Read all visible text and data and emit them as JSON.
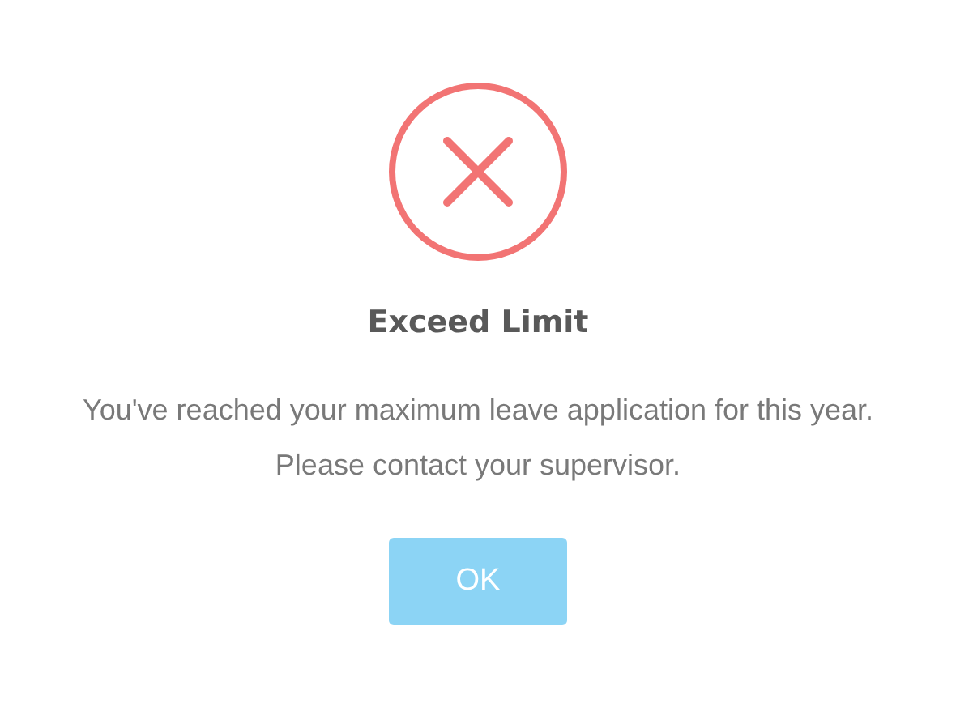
{
  "dialog": {
    "kind": "error",
    "title": "Exceed Limit",
    "message": "You've reached your maximum leave application for this year. Please contact your supervisor.",
    "buttons": [
      "OK"
    ]
  }
}
